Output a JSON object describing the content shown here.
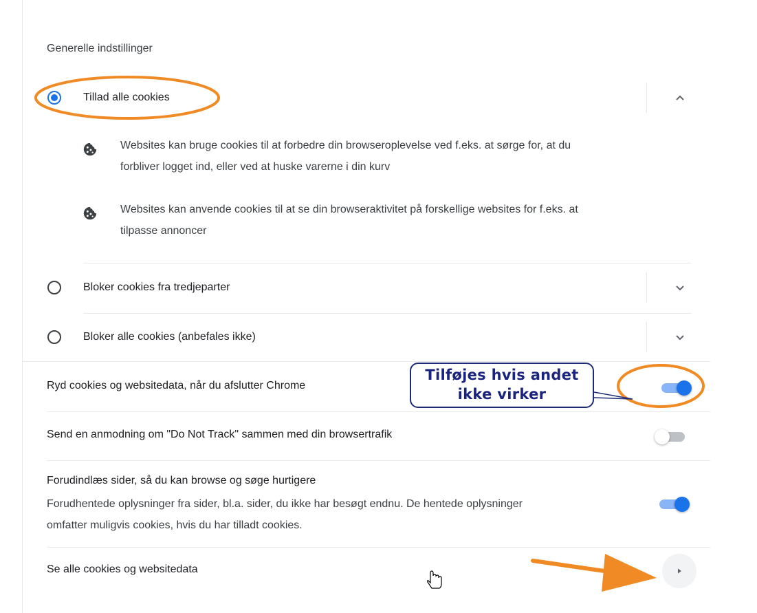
{
  "section_title": "Generelle indstillinger",
  "radio_options": [
    {
      "label": "Tillad alle cookies",
      "checked": true,
      "expanded": true
    },
    {
      "label": "Bloker cookies fra tredjeparter",
      "checked": false,
      "expanded": false
    },
    {
      "label": "Bloker alle cookies (anbefales ikke)",
      "checked": false,
      "expanded": false
    }
  ],
  "expanded_descriptions": [
    {
      "icon": "cookie-icon",
      "line1": "Websites kan bruge cookies til at forbedre din browseroplevelse ved f.eks. at sørge for, at du",
      "line2": "forbliver logget ind, eller ved at huske varerne i din kurv"
    },
    {
      "icon": "cookie-icon",
      "line1": "Websites kan anvende cookies til at se din browseraktivitet på forskellige websites for f.eks. at",
      "line2": "tilpasse annoncer"
    }
  ],
  "settings": {
    "clear_on_exit": {
      "label": "Ryd cookies og websitedata, når du afslutter Chrome",
      "enabled": true
    },
    "do_not_track": {
      "label": "Send en anmodning om \"Do Not Track\" sammen med din browsertrafik",
      "enabled": false
    },
    "preload": {
      "label": "Forudindlæs sider, så du kan browse og søge hurtigere",
      "sub_line1": "Forudhentede oplysninger fra sider, bl.a. sider, du ikke har besøgt endnu. De hentede oplysninger",
      "sub_line2": "omfatter muligvis cookies, hvis du har tilladt cookies.",
      "enabled": true
    },
    "see_all": {
      "label": "Se alle cookies og websitedata"
    }
  },
  "annotation": {
    "line1": "Tilføjes hvis andet",
    "line2": "ikke virker"
  },
  "colors": {
    "accent": "#1a73e8",
    "annotation_orange": "#f08a24",
    "callout_text": "#1a237e"
  }
}
